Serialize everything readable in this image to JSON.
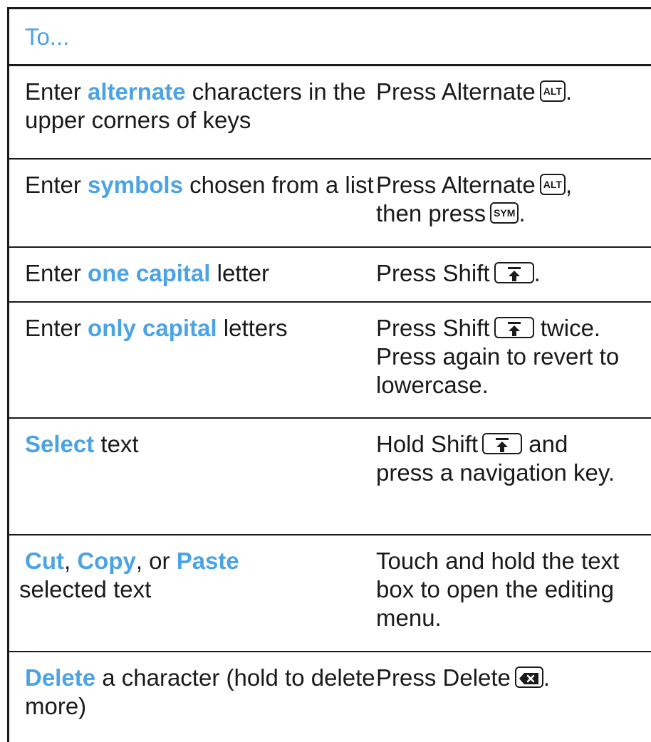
{
  "header": "To...",
  "rows": [
    {
      "left": {
        "pre": "Enter ",
        "hl": "alternate",
        "post": " characters in the upper corners of keys"
      },
      "right": {
        "pre": "Press Alternate",
        "key": "ALT",
        "post": "."
      }
    },
    {
      "left": {
        "pre": "Enter ",
        "hl": "symbols",
        "post": " chosen from a list"
      },
      "right": {
        "pre": "Press Alternate",
        "key": "ALT",
        "post": ",",
        "line2": "then press",
        "key2": "SYM",
        "post2": "."
      }
    },
    {
      "left": {
        "pre": "Enter ",
        "hl": "one capital",
        "post": " letter"
      },
      "right": {
        "pre": "Press Shift",
        "post": "."
      }
    },
    {
      "left": {
        "pre": "Enter ",
        "hl": "only capital",
        "post": " letters"
      },
      "right": {
        "pre": "Press Shift",
        "post": " twice. Press again to revert to lowercase."
      }
    },
    {
      "left": {
        "hl": "Select",
        "post": " text"
      },
      "right": {
        "pre": "Hold Shift",
        "post": " and press a navigation key."
      }
    },
    {
      "left": {
        "hl": "Cut",
        "sep1": ", ",
        "hl2": "Copy",
        "sep2": ", or ",
        "hl3": "Paste",
        "post": " selected text"
      },
      "right": {
        "pre": "Touch and hold the text box to open the editing menu."
      }
    },
    {
      "left": {
        "hl": "Delete",
        "post": " a character (hold to delete more)"
      },
      "right": {
        "pre": "Press Delete",
        "post": "."
      }
    }
  ],
  "icons": {
    "shift": "shift-key-icon",
    "delete": "delete-key-icon"
  }
}
